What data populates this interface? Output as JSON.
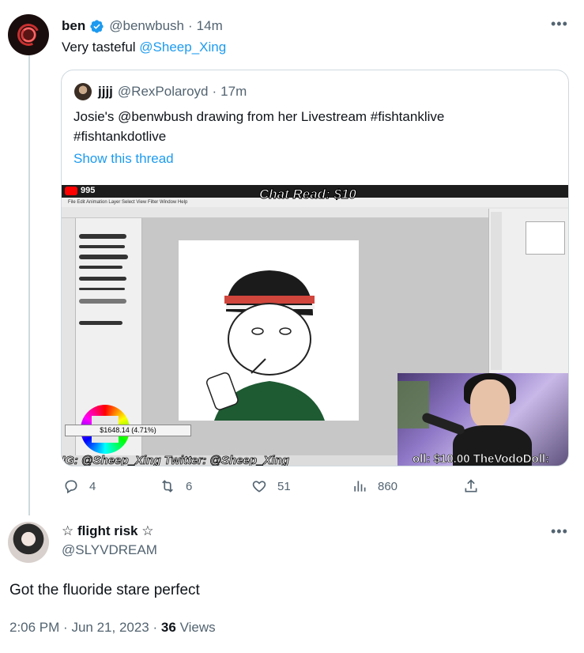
{
  "parent_tweet": {
    "name": "ben",
    "handle": "@benwbush",
    "time": "14m",
    "separator": "·",
    "text_prefix": "Very tasteful ",
    "mention": "@Sheep_Xing"
  },
  "quoted_tweet": {
    "name": "jjjj",
    "handle": "@RexPolaroyd",
    "time": "17m",
    "separator": "·",
    "text_line1": "Josie's @benwbush drawing from her Livestream #fishtanklive",
    "text_line2": "#fishtankdotlive",
    "show_thread": "Show this thread",
    "media": {
      "viewers": "995",
      "chat_read": "Chat Read: $10",
      "menu": "File   Edit   Animation   Layer   Select   View   Filter   Window   Help",
      "amount": "$1648.14 (4.71%)",
      "overlay_left": "IG: @Sheep_Xing  Twitter: @Sheep_Xing",
      "overlay_right": "oll: $10.00  TheVodoDoll:"
    }
  },
  "actions": {
    "replies": "4",
    "retweets": "6",
    "likes": "51",
    "views": "860"
  },
  "main_tweet": {
    "name": "☆ flight risk ☆",
    "handle": "@SLYVDREAM",
    "text": "Got the fluoride stare perfect",
    "time": "2:06 PM",
    "date": "Jun 21, 2023",
    "separator": "·",
    "views_count": "36",
    "views_label": "Views"
  },
  "colors": {
    "link": "#1d9bf0",
    "secondary_text": "#536471",
    "border": "#cfd9de"
  },
  "icons": [
    "verified-badge-icon",
    "more-icon",
    "reply-icon",
    "retweet-icon",
    "like-icon",
    "views-icon",
    "share-icon"
  ]
}
